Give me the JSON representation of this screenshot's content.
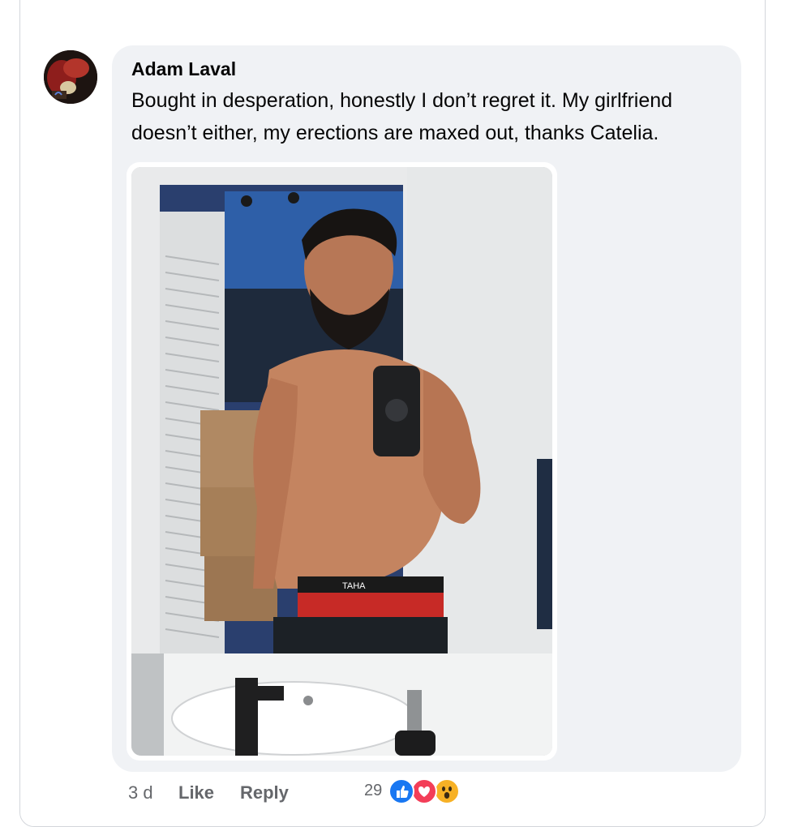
{
  "comment": {
    "author": "Adam Laval",
    "text": "Bought in desperation, honestly I don’t regret it. My girlfriend doesn’t either, my erections are maxed out, thanks Catelia.",
    "attachment": {
      "waistband_text": "TAHA"
    },
    "meta": {
      "time": "3 d",
      "like_label": "Like",
      "reply_label": "Reply"
    },
    "reactions": {
      "count": "29",
      "types": [
        "like-icon",
        "love-icon",
        "wow-icon"
      ]
    }
  },
  "colors": {
    "bubble": "#f0f2f5",
    "text": "#050505",
    "meta_text": "#65676b",
    "like": "#1877f2",
    "love": "#f33e58",
    "wow": "#f7b125"
  }
}
